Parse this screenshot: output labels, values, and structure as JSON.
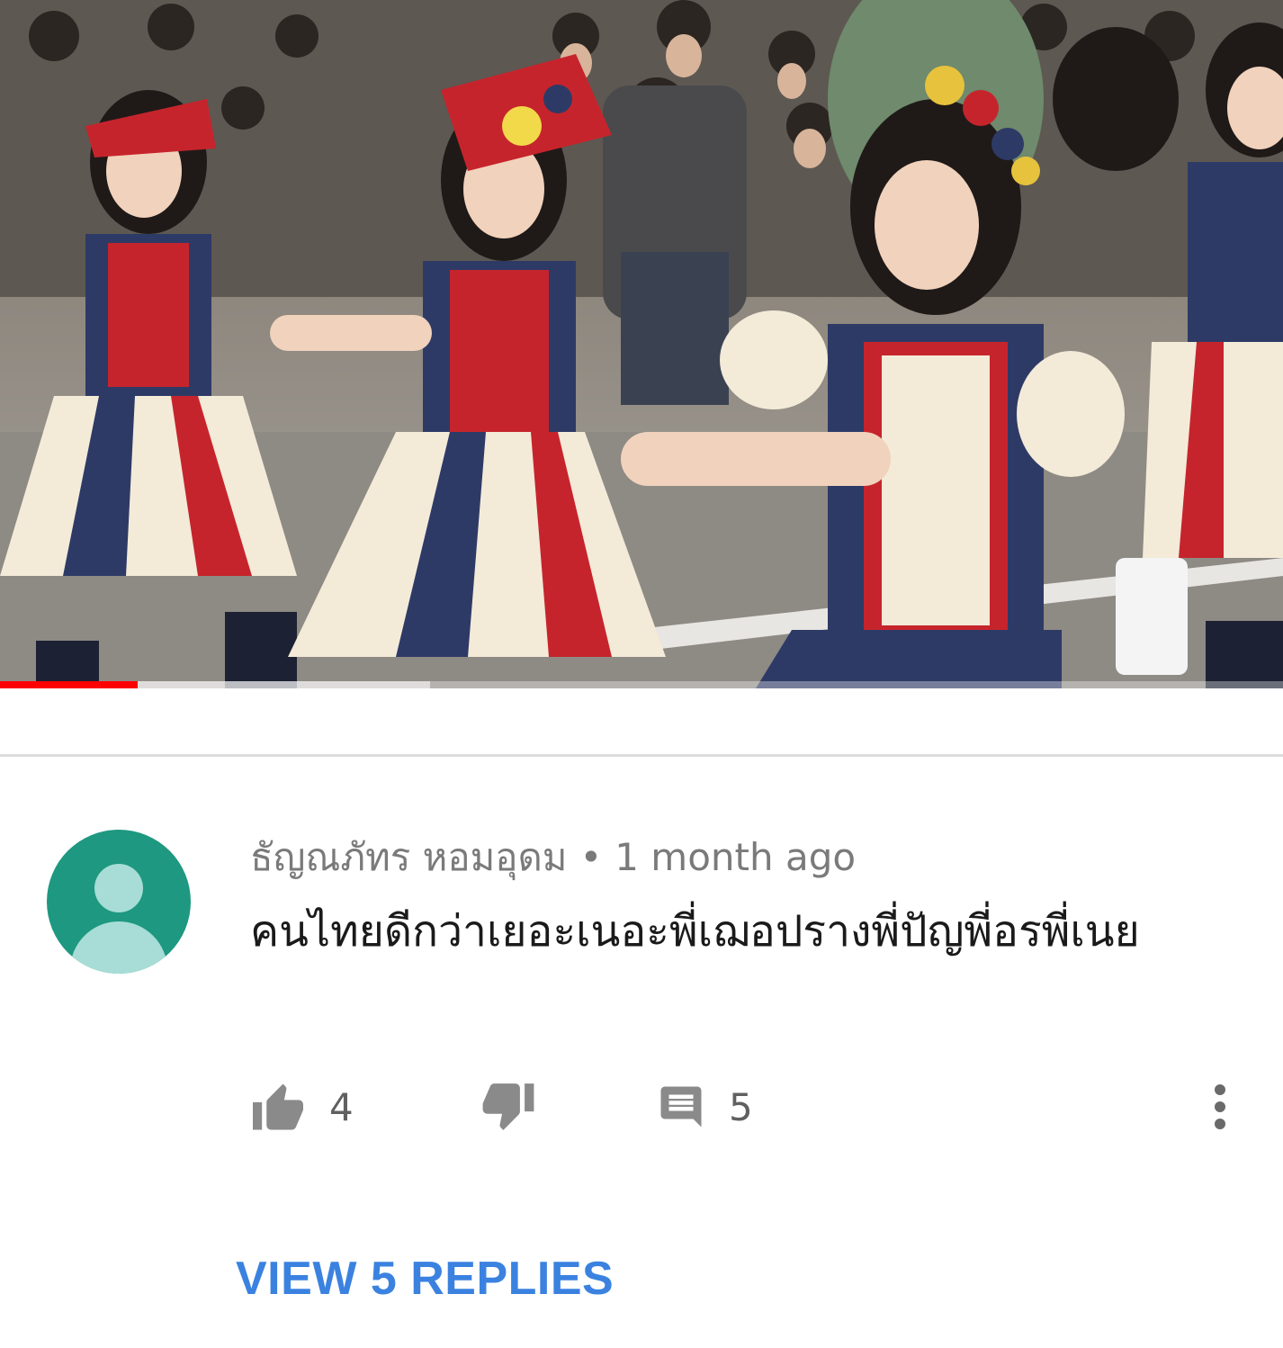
{
  "video": {
    "progress_fraction": 0.107,
    "buffered_fraction": 0.335,
    "accent_color": "#ff0000"
  },
  "comment": {
    "avatar_icon": "default-avatar-icon",
    "avatar_color": "#1e9880",
    "author": "ธัญณภัทร หอมอุดม",
    "separator": "•",
    "time": "1 month ago",
    "text": "คนไทยดีกว่าเยอะเนอะพี่เฌอปรางพี่ปัญพี่อรพี่เนย",
    "likes": "4",
    "replies_count": "5",
    "like_icon": "thumb-up-icon",
    "dislike_icon": "thumb-down-icon",
    "reply_icon": "comment-icon",
    "more_icon": "more-vertical-icon"
  },
  "view_replies_label": "VIEW 5 REPLIES",
  "view_replies_color": "#3b82e0"
}
